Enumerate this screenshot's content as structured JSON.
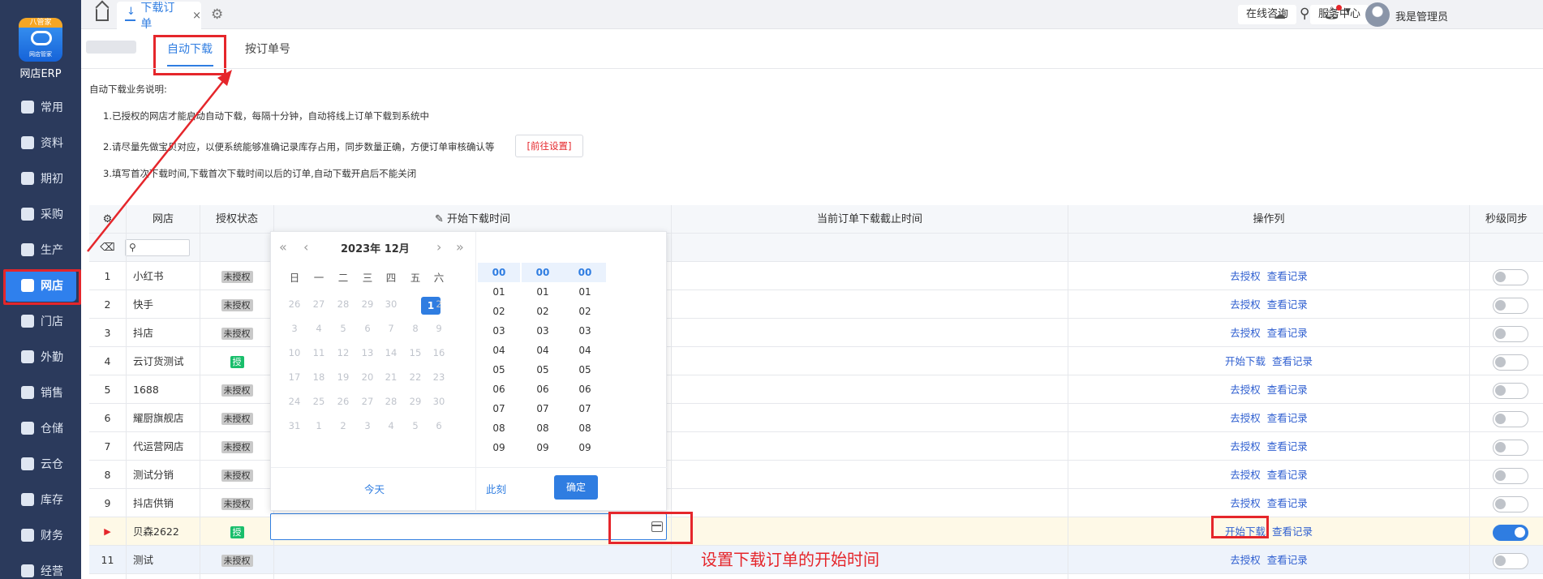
{
  "app": {
    "badge": "八管家",
    "logo_sub": "网店管家",
    "name": "网店ERP"
  },
  "sidebar": {
    "items": [
      {
        "label": "常用"
      },
      {
        "label": "资料"
      },
      {
        "label": "期初"
      },
      {
        "label": "采购"
      },
      {
        "label": "生产"
      },
      {
        "label": "网店",
        "active": true
      },
      {
        "label": "门店"
      },
      {
        "label": "外勤"
      },
      {
        "label": "销售"
      },
      {
        "label": "仓储"
      },
      {
        "label": "云仓"
      },
      {
        "label": "库存"
      },
      {
        "label": "财务"
      },
      {
        "label": "经营"
      }
    ]
  },
  "topbar": {
    "tab_label": "下载订单",
    "close": "×",
    "online_consult": "在线咨询",
    "service_center": "服务中心",
    "user": "我是管理员"
  },
  "subtabs": {
    "auto": "自动下载",
    "by_order": "按订单号"
  },
  "instructions": {
    "heading": "自动下载业务说明:",
    "line1": "1.已授权的网店才能启动自动下载，每隔十分钟，自动将线上订单下载到系统中",
    "line2": "2.请尽量先做宝贝对应，以便系统能够准确记录库存占用，同步数量正确，方便订单审核确认等",
    "go_settings": "[前往设置]",
    "line3": "3.填写首次下载时间,下载首次下载时间以后的订单,自动下载开启后不能关闭"
  },
  "table": {
    "columns": {
      "shop": "网店",
      "auth": "授权状态",
      "start_time": "开始下载时间",
      "cutoff_time": "当前订单下载截止时间",
      "ops": "操作列",
      "sync": "秒级同步"
    },
    "rows": [
      {
        "no": "1",
        "shop": "小红书",
        "auth": "未授权",
        "op1": "去授权",
        "op2": "查看记录"
      },
      {
        "no": "2",
        "shop": "快手",
        "auth": "未授权",
        "op1": "去授权",
        "op2": "查看记录"
      },
      {
        "no": "3",
        "shop": "抖店",
        "auth": "未授权",
        "op1": "去授权",
        "op2": "查看记录"
      },
      {
        "no": "4",
        "shop": "云订货测试",
        "auth": "授",
        "op1": "开始下载",
        "op2": "查看记录"
      },
      {
        "no": "5",
        "shop": "1688",
        "auth": "未授权",
        "op1": "去授权",
        "op2": "查看记录"
      },
      {
        "no": "6",
        "shop": "耀厨旗舰店",
        "auth": "未授权",
        "op1": "去授权",
        "op2": "查看记录"
      },
      {
        "no": "7",
        "shop": "代运营网店",
        "auth": "未授权",
        "op1": "去授权",
        "op2": "查看记录"
      },
      {
        "no": "8",
        "shop": "测试分销",
        "auth": "未授权",
        "op1": "去授权",
        "op2": "查看记录"
      },
      {
        "no": "9",
        "shop": "抖店供销",
        "auth": "未授权",
        "op1": "去授权",
        "op2": "查看记录"
      },
      {
        "no": "▶",
        "shop": "贝森2622",
        "auth": "授",
        "op1": "开始下载",
        "op2": "查看记录"
      },
      {
        "no": "11",
        "shop": "测试",
        "auth": "未授权",
        "op1": "去授权",
        "op2": "查看记录"
      }
    ]
  },
  "datepicker": {
    "title": "2023年 12月",
    "nav": {
      "prev_year": "«",
      "prev_month": "‹",
      "next_month": "›",
      "next_year": "»"
    },
    "weekdays": [
      "日",
      "一",
      "二",
      "三",
      "四",
      "五",
      "六"
    ],
    "weeks": [
      [
        "26",
        "27",
        "28",
        "29",
        "30",
        "1",
        "2"
      ],
      [
        "3",
        "4",
        "5",
        "6",
        "7",
        "8",
        "9"
      ],
      [
        "10",
        "11",
        "12",
        "13",
        "14",
        "15",
        "16"
      ],
      [
        "17",
        "18",
        "19",
        "20",
        "21",
        "22",
        "23"
      ],
      [
        "24",
        "25",
        "26",
        "27",
        "28",
        "29",
        "30"
      ],
      [
        "31",
        "1",
        "2",
        "3",
        "4",
        "5",
        "6"
      ]
    ],
    "selected_day": "1",
    "hours": [
      "00",
      "01",
      "02",
      "03",
      "04",
      "05",
      "06",
      "07",
      "08",
      "09"
    ],
    "minutes": [
      "00",
      "01",
      "02",
      "03",
      "04",
      "05",
      "06",
      "07",
      "08",
      "09"
    ],
    "seconds": [
      "00",
      "01",
      "02",
      "03",
      "04",
      "05",
      "06",
      "07",
      "08",
      "09"
    ],
    "today": "今天",
    "now": "此刻",
    "ok": "确定"
  },
  "annotation": "设置下载订单的开始时间",
  "colors": {
    "accent": "#2f7de1",
    "sidebar": "#2b3a5c",
    "highlight": "#e5262b"
  }
}
